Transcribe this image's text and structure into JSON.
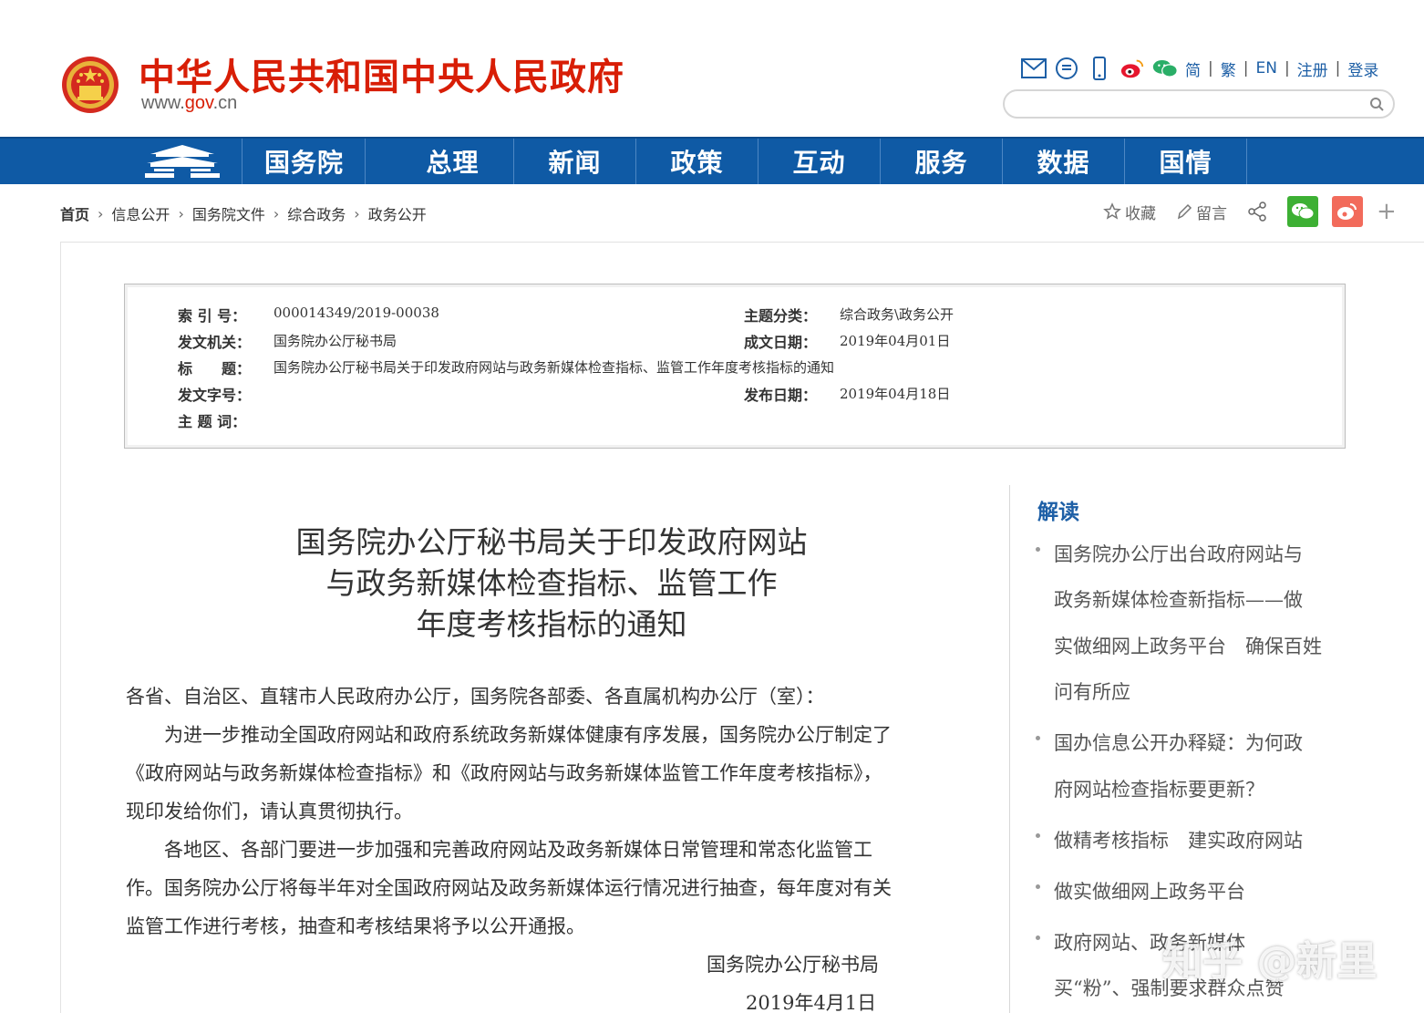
{
  "header": {
    "site_title": "中华人民共和国中央人民政府",
    "site_url_prefix": "www.",
    "site_url_accent": "gov",
    "site_url_suffix": ".cn",
    "links": [
      "简",
      "繁",
      "EN",
      "注册",
      "登录"
    ],
    "search_placeholder": ""
  },
  "nav": {
    "items": [
      "国务院",
      "总理",
      "新闻",
      "政策",
      "互动",
      "服务",
      "数据",
      "国情"
    ]
  },
  "breadcrumb": [
    "首页",
    "信息公开",
    "国务院文件",
    "综合政务",
    "政务公开"
  ],
  "share": {
    "favorite": "收藏",
    "comment": "留言"
  },
  "meta": {
    "index_label": "索 引 号：",
    "index_value": "000014349/2019-00038",
    "topic_label": "主题分类：",
    "topic_value": "综合政务\\政务公开",
    "issuer_label": "发文机关：",
    "issuer_value": "国务院办公厅秘书局",
    "written_label": "成文日期：",
    "written_value": "2019年04月01日",
    "title_label": "标　　题：",
    "title_value": "国务院办公厅秘书局关于印发政府网站与政务新媒体检查指标、监管工作年度考核指标的通知",
    "docno_label": "发文字号：",
    "docno_value": "",
    "published_label": "发布日期：",
    "published_value": "2019年04月18日",
    "keywords_label": "主 题 词：",
    "keywords_value": ""
  },
  "article": {
    "title_lines": [
      "国务院办公厅秘书局关于印发政府网站",
      "与政务新媒体检查指标、监管工作",
      "年度考核指标的通知"
    ],
    "salutation": "各省、自治区、直辖市人民政府办公厅，国务院各部委、各直属机构办公厅（室）：",
    "p1_lines": [
      "　　为进一步推动全国政府网站和政府系统政务新媒体健康有序发展，国务院办公厅制定了",
      "《政府网站与政务新媒体检查指标》和《政府网站与政务新媒体监管工作年度考核指标》，",
      "现印发给你们，请认真贯彻执行。"
    ],
    "p2_lines": [
      "　　各地区、各部门要进一步加强和完善政府网站及政务新媒体日常管理和常态化监管工",
      "作。国务院办公厅将每半年对全国政府网站及政务新媒体运行情况进行抽查，每年度对有关",
      "监管工作进行考核，抽查和考核结果将予以公开通报。"
    ],
    "signature": "国务院办公厅秘书局",
    "date": "2019年4月1日"
  },
  "sidebar": {
    "heading": "解读",
    "items": [
      [
        "国务院办公厅出台政府网站与",
        "政务新媒体检查新指标——做",
        "实做细网上政务平台　确保百姓",
        "问有所应"
      ],
      [
        "国办信息公开办释疑：为何政",
        "府网站检查指标要更新？"
      ],
      [
        "做精考核指标　建实政府网站"
      ],
      [
        "做实做细网上政务平台"
      ],
      [
        "政府网站、政务新媒体",
        "买“粉”、强制要求群众点赞"
      ]
    ]
  },
  "watermark": "知乎 @新里",
  "colors": {
    "brand_red": "#d81e06",
    "nav_blue": "#0f5aa5",
    "link_blue": "#1d5fa6",
    "wechat_green": "#3db034",
    "weibo_red": "#f26b5b"
  }
}
